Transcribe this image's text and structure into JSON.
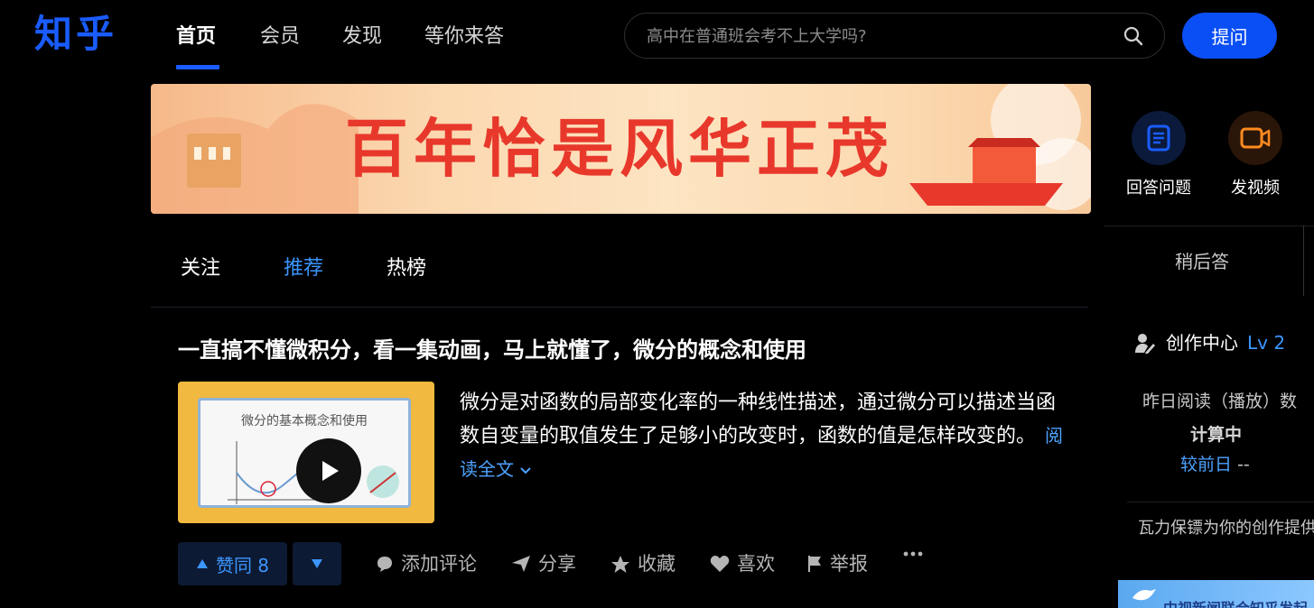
{
  "header": {
    "logo": "知乎",
    "nav": [
      "首页",
      "会员",
      "发现",
      "等你来答"
    ],
    "search_placeholder": "高中在普通班会考不上大学吗?",
    "ask_button": "提问"
  },
  "banner": {
    "title": "百年恰是风华正茂"
  },
  "tabs": [
    "关注",
    "推荐",
    "热榜"
  ],
  "feed": {
    "title": "一直搞不懂微积分，看一集动画，马上就懂了，微分的概念和使用",
    "thumbnail_title": "微分的基本概念和使用",
    "excerpt": "微分是对函数的局部变化率的一种线性描述，通过微分可以描述当函数自变量的取值发生了足够小的改变时，函数的值是怎样改变的。",
    "read_more": "阅读全文",
    "vote_up": "赞同 8",
    "actions": [
      "添加评论",
      "分享",
      "收藏",
      "喜欢",
      "举报"
    ]
  },
  "sidebar": {
    "answer_label": "回答问题",
    "video_label": "发视频",
    "later_label": "稍后答",
    "creator_center": "创作中心",
    "level": "Lv 2",
    "stat_label": "昨日阅读（播放）数",
    "stat_value": "计算中",
    "compare_label": "较前日",
    "compare_value": "--",
    "promo": "瓦力保镖为你的创作提供",
    "bottom_banner_text": "中视新闻联合知乎发起"
  },
  "colors": {
    "brand": "#0a4ff5",
    "accent": "#3b96ff",
    "background": "#000000"
  }
}
